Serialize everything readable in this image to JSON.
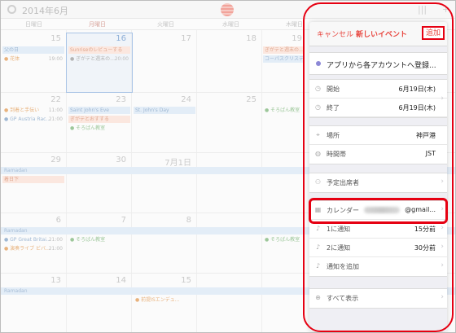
{
  "calendar": {
    "month_title": "2014年6月",
    "days_of_week": [
      "日曜日",
      "月曜日",
      "火曜日",
      "水曜日",
      "木曜日"
    ],
    "weeks": [
      {
        "days": [
          "15",
          "16",
          "17",
          "18",
          "19"
        ],
        "events": [
          {
            "text": "父の日",
            "style": "blue"
          },
          {
            "text": "● 花体",
            "time": "19:00",
            "style": "dot orange"
          },
          {
            "text": "Sunriseのレビューする",
            "style": "orange"
          },
          {
            "text": "● ぎがテと週末の…",
            "time": "20:00",
            "style": "dot"
          },
          {
            "text": "ぎがテと週末の…",
            "style": "orange"
          },
          {
            "text": "コーパスクリスティ",
            "style": "blue"
          }
        ]
      },
      {
        "days": [
          "22",
          "23",
          "24",
          "25"
        ],
        "events": [
          {
            "text": "● 到着と手伝い",
            "time": "11:00",
            "style": "dot orange"
          },
          {
            "text": "● GP Austria Rac...",
            "time": "21:00",
            "style": "dot blue"
          },
          {
            "text": "Saint John's Eve",
            "style": "blue"
          },
          {
            "text": "ぎがテとおすする",
            "style": "orange"
          },
          {
            "text": "● そろばん教室",
            "style": "dot green"
          },
          {
            "text": "St. John's Day",
            "style": "blue"
          },
          {
            "text": "● そろばん教室",
            "style": "dot green"
          }
        ]
      },
      {
        "days": [
          "29",
          "30",
          "7月1日"
        ],
        "events": [
          {
            "text": "Ramadan",
            "style": "band"
          },
          {
            "text": "着日下",
            "style": "orange"
          }
        ]
      },
      {
        "days": [
          "6",
          "7",
          "8"
        ],
        "events": [
          {
            "text": "Ramadan",
            "style": "band"
          },
          {
            "text": "● GP Great Britai...",
            "time": "21:00",
            "style": "dot blue"
          },
          {
            "text": "● 演奏ライブ ビバ...",
            "time": "21:00",
            "style": "dot orange"
          },
          {
            "text": "● そろばん教室",
            "style": "dot green"
          },
          {
            "text": "● そろばん教室",
            "style": "dot green"
          }
        ]
      },
      {
        "days": [
          "13",
          "14",
          "15"
        ],
        "events": [
          {
            "text": "Ramadan",
            "style": "band"
          },
          {
            "text": "● 前提ISエンデュ...",
            "style": "dot orange"
          }
        ]
      }
    ]
  },
  "event_form": {
    "cancel_label": "キャンセル",
    "title": "新しいイベント",
    "add_label": "追加",
    "event_title": "アプリから各アカウントへ登録...",
    "start_label": "開始",
    "start_value": "6月19日(木)",
    "end_label": "終了",
    "end_value": "6月19日(木)",
    "location_label": "場所",
    "location_value": "神戸港",
    "timezone_label": "時間帯",
    "timezone_value": "JST",
    "invitees_label": "予定出席者",
    "calendar_label": "カレンダー",
    "calendar_value": "@gmail...",
    "alert1_label": "1に通知",
    "alert1_value": "15分前",
    "alert2_label": "2に通知",
    "alert2_value": "30分前",
    "add_alert_label": "通知を追加",
    "show_all_label": "すべて表示"
  },
  "colors": {
    "accent": "#e8463f",
    "highlight": "#e60012",
    "calendar_dot": "#8c88d6"
  }
}
